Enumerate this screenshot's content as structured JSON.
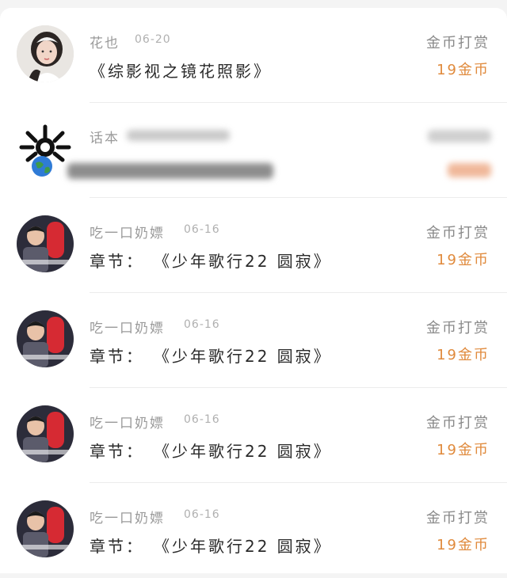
{
  "entries": [
    {
      "name": "花也",
      "date": "06-20",
      "chapter_prefix": "",
      "title": "《综影视之镜花照影》",
      "tip_label": "金币打赏",
      "tip_amount": "19金币",
      "avatar": "avatar-girl"
    },
    {
      "name": "话本",
      "date": "",
      "chapter_prefix": "",
      "title": "",
      "tip_label": "",
      "tip_amount": "",
      "avatar": "avatar-logo-earth"
    },
    {
      "name": "吃一口奶嫖",
      "date": "06-16",
      "chapter_prefix": "章节：",
      "title": "《少年歌行22 圆寂》",
      "tip_label": "金币打赏",
      "tip_amount": "19金币",
      "avatar": "avatar-boy-red"
    },
    {
      "name": "吃一口奶嫖",
      "date": "06-16",
      "chapter_prefix": "章节：",
      "title": "《少年歌行22 圆寂》",
      "tip_label": "金币打赏",
      "tip_amount": "19金币",
      "avatar": "avatar-boy-red"
    },
    {
      "name": "吃一口奶嫖",
      "date": "06-16",
      "chapter_prefix": "章节：",
      "title": "《少年歌行22 圆寂》",
      "tip_label": "金币打赏",
      "tip_amount": "19金币",
      "avatar": "avatar-boy-red"
    },
    {
      "name": "吃一口奶嫖",
      "date": "06-16",
      "chapter_prefix": "章节：",
      "title": "《少年歌行22 圆寂》",
      "tip_label": "金币打赏",
      "tip_amount": "19金币",
      "avatar": "avatar-boy-red"
    }
  ],
  "colors": {
    "accent": "#e08a3c",
    "name": "#9a9a9a",
    "title": "#2a2a2a"
  }
}
